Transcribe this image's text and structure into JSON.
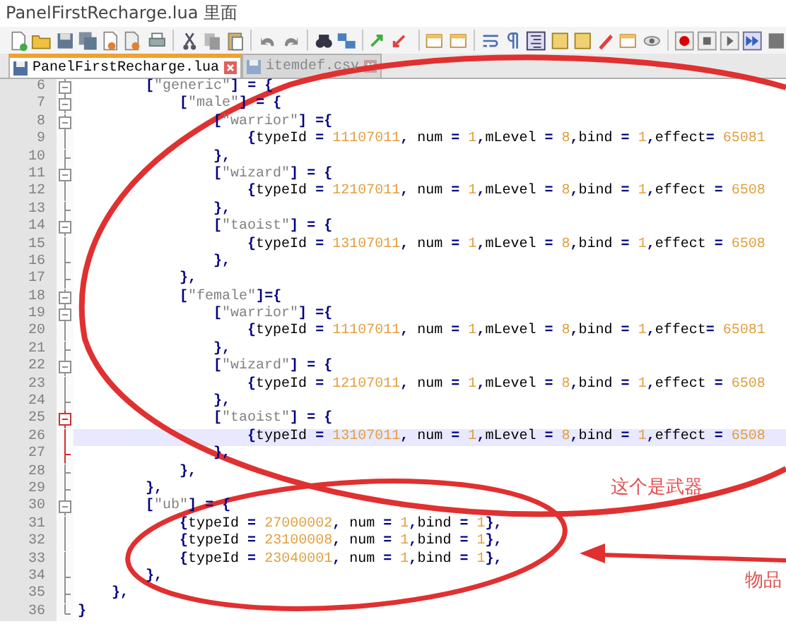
{
  "caption": "PanelFirstRecharge.lua 里面",
  "tabs": [
    {
      "label": "PanelFirstRecharge.lua",
      "selected": true
    },
    {
      "label": "itemdef.csv",
      "selected": false
    }
  ],
  "editor": {
    "lines": [
      {
        "number": "6",
        "text": "        [\"generic\"] = {",
        "kind": "open",
        "current": false,
        "in_active_block": false
      },
      {
        "number": "7",
        "text": "            [\"male\"] = {",
        "kind": "open",
        "current": false,
        "in_active_block": false
      },
      {
        "number": "8",
        "text": "                [\"warrior\"] ={",
        "kind": "open",
        "current": false,
        "in_active_block": false
      },
      {
        "number": "9",
        "text": "                    {typeId = 11107011, num = 1,mLevel = 8,bind = 1,effect= 65081",
        "kind": "line",
        "current": false,
        "in_active_block": false
      },
      {
        "number": "10",
        "text": "                },",
        "kind": "end",
        "current": false,
        "in_active_block": false
      },
      {
        "number": "11",
        "text": "                [\"wizard\"] = {",
        "kind": "open",
        "current": false,
        "in_active_block": false
      },
      {
        "number": "12",
        "text": "                    {typeId = 12107011, num = 1,mLevel = 8,bind = 1,effect = 6508",
        "kind": "line",
        "current": false,
        "in_active_block": false
      },
      {
        "number": "13",
        "text": "                },",
        "kind": "end",
        "current": false,
        "in_active_block": false
      },
      {
        "number": "14",
        "text": "                [\"taoist\"] = {",
        "kind": "open",
        "current": false,
        "in_active_block": false
      },
      {
        "number": "15",
        "text": "                    {typeId = 13107011, num = 1,mLevel = 8,bind = 1,effect = 6508",
        "kind": "line",
        "current": false,
        "in_active_block": false
      },
      {
        "number": "16",
        "text": "                },",
        "kind": "end",
        "current": false,
        "in_active_block": false
      },
      {
        "number": "17",
        "text": "            },",
        "kind": "end",
        "current": false,
        "in_active_block": false
      },
      {
        "number": "18",
        "text": "            [\"female\"]={",
        "kind": "open",
        "current": false,
        "in_active_block": false
      },
      {
        "number": "19",
        "text": "                [\"warrior\"] ={",
        "kind": "open",
        "current": false,
        "in_active_block": false
      },
      {
        "number": "20",
        "text": "                    {typeId = 11107011, num = 1,mLevel = 8,bind = 1,effect= 65081",
        "kind": "line",
        "current": false,
        "in_active_block": false
      },
      {
        "number": "21",
        "text": "                },",
        "kind": "end",
        "current": false,
        "in_active_block": false
      },
      {
        "number": "22",
        "text": "                [\"wizard\"] = {",
        "kind": "open",
        "current": false,
        "in_active_block": false
      },
      {
        "number": "23",
        "text": "                    {typeId = 12107011, num = 1,mLevel = 8,bind = 1,effect = 6508",
        "kind": "line",
        "current": false,
        "in_active_block": false
      },
      {
        "number": "24",
        "text": "                },",
        "kind": "end",
        "current": false,
        "in_active_block": false
      },
      {
        "number": "25",
        "text": "                [\"taoist\"] = {",
        "kind": "open",
        "current": false,
        "in_active_block": true
      },
      {
        "number": "26",
        "text": "                    {typeId = 13107011, num = 1,mLevel = 8,bind = 1,effect = 6508",
        "kind": "line",
        "current": true,
        "in_active_block": true
      },
      {
        "number": "27",
        "text": "                },",
        "kind": "end",
        "current": false,
        "in_active_block": true
      },
      {
        "number": "28",
        "text": "            },",
        "kind": "end",
        "current": false,
        "in_active_block": false
      },
      {
        "number": "29",
        "text": "        },",
        "kind": "end",
        "current": false,
        "in_active_block": false
      },
      {
        "number": "30",
        "text": "        [\"ub\"] = {",
        "kind": "open",
        "current": false,
        "in_active_block": false
      },
      {
        "number": "31",
        "text": "            {typeId = 27000002, num = 1,bind = 1},",
        "kind": "line",
        "current": false,
        "in_active_block": false
      },
      {
        "number": "32",
        "text": "            {typeId = 23100008, num = 1,bind = 1},",
        "kind": "line",
        "current": false,
        "in_active_block": false
      },
      {
        "number": "33",
        "text": "            {typeId = 23040001, num = 1,bind = 1},",
        "kind": "line",
        "current": false,
        "in_active_block": false
      },
      {
        "number": "34",
        "text": "        },",
        "kind": "end",
        "current": false,
        "in_active_block": false
      },
      {
        "number": "35",
        "text": "    },",
        "kind": "end",
        "current": false,
        "in_active_block": false
      },
      {
        "number": "36",
        "text": "}",
        "kind": "last",
        "current": false,
        "in_active_block": false
      }
    ]
  },
  "annotations": [
    {
      "text": "这个是武器"
    },
    {
      "text": "物品"
    }
  ]
}
